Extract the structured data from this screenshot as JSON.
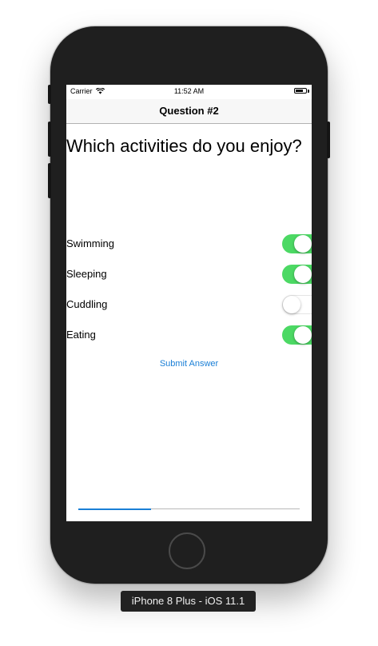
{
  "status_bar": {
    "carrier": "Carrier",
    "time": "11:52 AM",
    "wifi_icon": "wifi-icon",
    "battery_icon": "battery-icon"
  },
  "nav": {
    "title": "Question #2"
  },
  "question": "Which activities do you enjoy?",
  "activities": [
    {
      "label": "Swimming",
      "on": true
    },
    {
      "label": "Sleeping",
      "on": true
    },
    {
      "label": "Cuddling",
      "on": false
    },
    {
      "label": "Eating",
      "on": true
    }
  ],
  "submit_label": "Submit Answer",
  "progress": {
    "fraction": 0.33
  },
  "device_label": "iPhone 8 Plus - iOS 11.1",
  "colors": {
    "switch_on": "#4cd964",
    "accent": "#1a7fd6",
    "device_body": "#1f1f1f"
  }
}
